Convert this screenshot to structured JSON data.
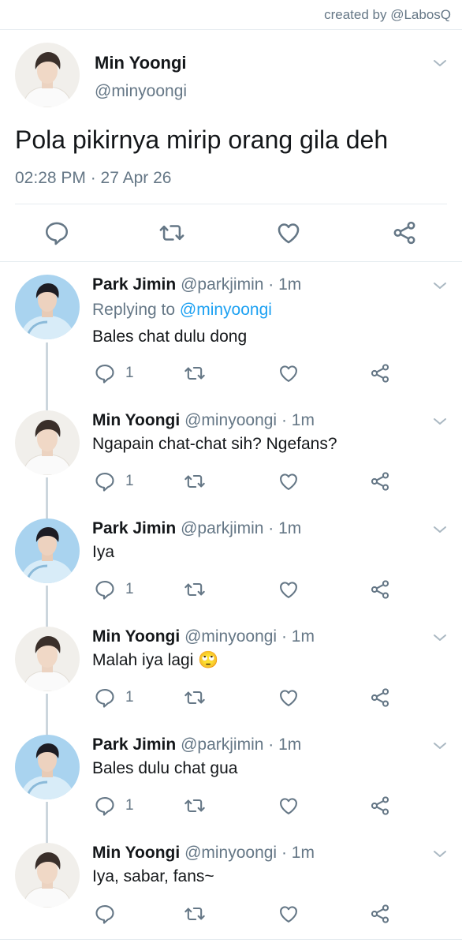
{
  "credit": "created by @LabosQ",
  "main_tweet": {
    "name": "Min Yoongi",
    "handle": "@minyoongi",
    "text": "Pola pikirnya mirip orang gila deh",
    "timestamp": "02:28 PM · 27 Apr 26"
  },
  "replies": [
    {
      "name": "Park Jimin",
      "handle": "@parkjimin",
      "sep": "·",
      "time": "1m",
      "replying_prefix": "Replying to",
      "replying_mention": "@minyoongi",
      "text": "Bales chat dulu dong",
      "reply_count": "1"
    },
    {
      "name": "Min Yoongi",
      "handle": "@minyoongi",
      "sep": "·",
      "time": "1m",
      "text": "Ngapain chat-chat sih? Ngefans?",
      "reply_count": "1"
    },
    {
      "name": "Park Jimin",
      "handle": "@parkjimin",
      "sep": "·",
      "time": "1m",
      "text": "Iya",
      "reply_count": "1"
    },
    {
      "name": "Min Yoongi",
      "handle": "@minyoongi",
      "sep": "·",
      "time": "1m",
      "text": "Malah iya lagi",
      "emoji": "🙄",
      "reply_count": "1"
    },
    {
      "name": "Park Jimin",
      "handle": "@parkjimin",
      "sep": "·",
      "time": "1m",
      "text": "Bales dulu chat gua",
      "reply_count": "1"
    },
    {
      "name": "Min Yoongi",
      "handle": "@minyoongi",
      "sep": "·",
      "time": "1m",
      "text": "Iya, sabar, fans~",
      "reply_count": ""
    }
  ],
  "icons": {
    "reply": "reply-icon",
    "retweet": "retweet-icon",
    "like": "heart-icon",
    "share": "share-icon",
    "more": "chevron-down-icon"
  },
  "colors": {
    "text": "#14171a",
    "secondary": "#657786",
    "link": "#1da1f2",
    "divider": "#e6ecf0",
    "thread_line": "#ccd6dd"
  }
}
